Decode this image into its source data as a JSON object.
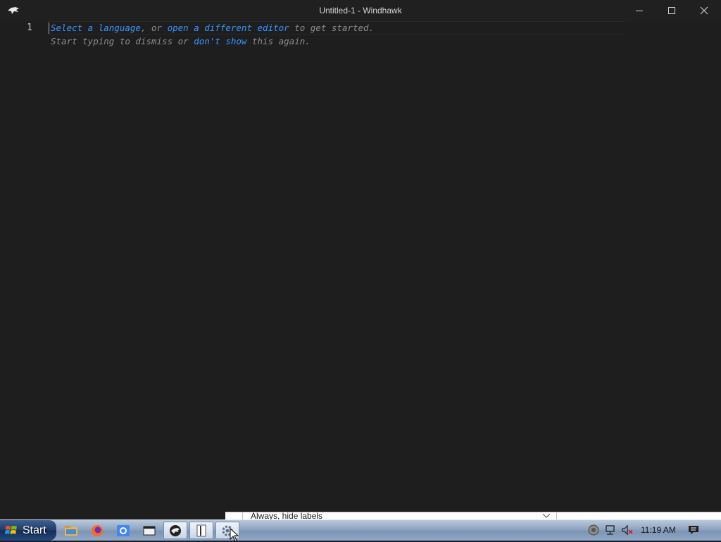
{
  "window": {
    "title": "Untitled-1 - Windhawk"
  },
  "editor": {
    "line_number": "1",
    "hint_line1": {
      "select_language": "Select a language",
      "sep1": ", or ",
      "open_editor": "open a different editor",
      "tail1": " to get started."
    },
    "hint_line2": {
      "start": "Start typing to dismiss or ",
      "dont_show": "don't show",
      "tail2": " this again."
    }
  },
  "taskbar": {
    "tooltip_text": "Always, hide labels",
    "start_label": "Start",
    "clock": "11:19 AM",
    "items": [
      {
        "name": "file-explorer",
        "active": false
      },
      {
        "name": "firefox",
        "active": false
      },
      {
        "name": "chrome",
        "active": false
      },
      {
        "name": "window-app",
        "active": false
      },
      {
        "name": "windhawk",
        "active": true
      },
      {
        "name": "notepad",
        "active": true
      },
      {
        "name": "settings",
        "active": true
      }
    ]
  },
  "colors": {
    "editor_bg": "#1e1e1e",
    "hint_text": "#8b8b8b",
    "link": "#3794ff"
  }
}
